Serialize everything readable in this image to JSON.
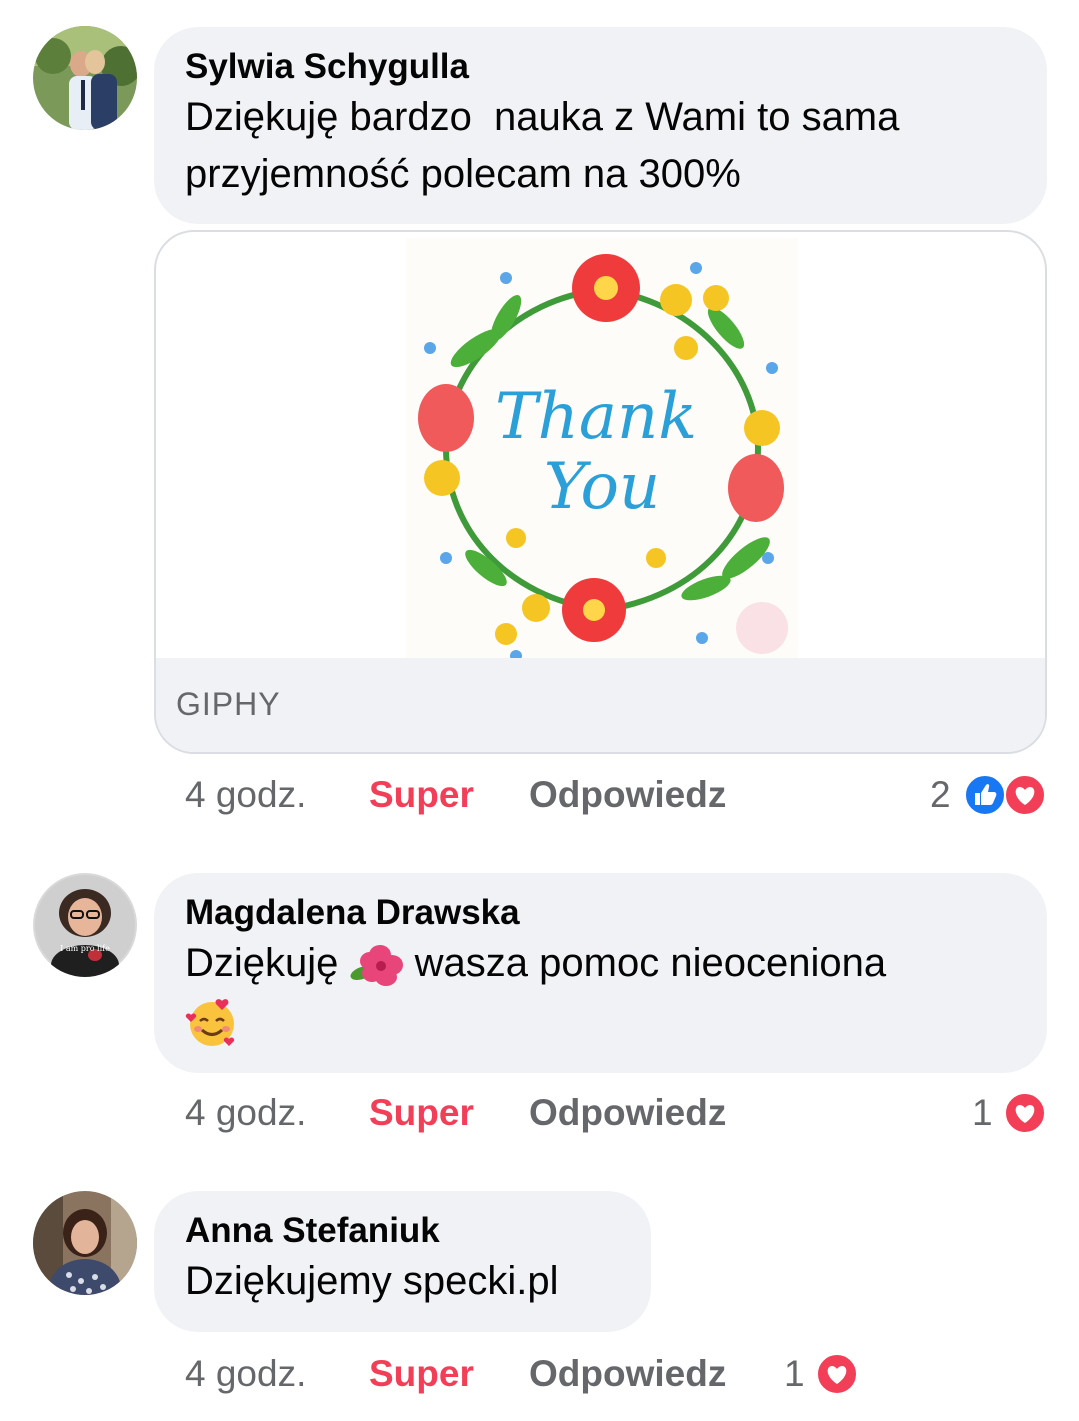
{
  "comments": [
    {
      "author": "Sylwia Schygulla",
      "text": "Dziękuję bardzo  nauka z Wami to sama przyjemność polecam na 300%",
      "line1": "Dziękuję bardzo  nauka z Wami to sama",
      "line2": "przyjemność polecam na 300%",
      "attachment": {
        "provider": "GIPHY",
        "gif_text_line1": "Thank",
        "gif_text_line2": "You"
      },
      "time": "4 godz.",
      "reaction_label": "Super",
      "reply_label": "Odpowiedz",
      "reaction_count": "2",
      "reactions": [
        "like-icon",
        "love-icon"
      ]
    },
    {
      "author": "Magdalena Drawska",
      "line1_a": "Dziękuję",
      "emoji1": "hibiscus-emoji",
      "line1_b": "wasza pomoc nieoceniona",
      "emoji2": "smiling-face-with-hearts-emoji",
      "avatar_caption": "I am pro life",
      "time": "4 godz.",
      "reaction_label": "Super",
      "reply_label": "Odpowiedz",
      "reaction_count": "1",
      "reactions": [
        "love-icon"
      ]
    },
    {
      "author": "Anna Stefaniuk",
      "text": "Dziękujemy specki.pl",
      "time": "4 godz.",
      "reaction_label": "Super",
      "reply_label": "Odpowiedz",
      "reaction_count": "1",
      "reactions": [
        "love-icon"
      ]
    }
  ],
  "colors": {
    "bubble": "#f0f2f5",
    "super": "#f33e58",
    "meta": "#65676b",
    "like_blue": "#1877f2",
    "love_red": "#f33e58"
  }
}
